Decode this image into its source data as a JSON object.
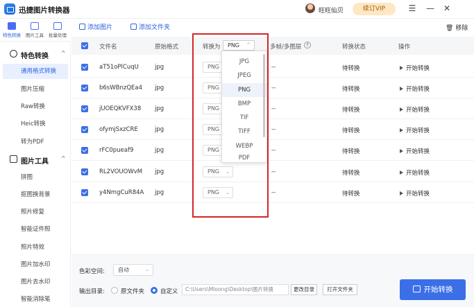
{
  "app": {
    "title": "迅捷图片转换器",
    "username": "旺旺仙贝",
    "vip_label": "续订VIP"
  },
  "window_controls": {
    "menu": "☰",
    "minimize": "—",
    "close": "✕"
  },
  "side_tabs": [
    {
      "label": "特色转换",
      "icon": "convert-icon"
    },
    {
      "label": "图片工具",
      "icon": "tools-icon"
    },
    {
      "label": "批量处理",
      "icon": "batch-icon"
    }
  ],
  "sidebar": {
    "group1": {
      "label": "特色转换",
      "chevron": "^"
    },
    "group1_items": [
      "通用格式转换",
      "图片压缩",
      "Raw转换",
      "Heic转换",
      "转为PDF"
    ],
    "group2": {
      "label": "图片工具",
      "chevron": "^"
    },
    "group2_items": [
      "拼图",
      "抠图换背景",
      "照片修复",
      "智能证件照",
      "照片特效",
      "图片加水印",
      "图片去水印",
      "智能消除笔"
    ]
  },
  "toolbar": {
    "add_image": "添加图片",
    "add_folder": "添加文件夹",
    "remove": "移除"
  },
  "table": {
    "headers": {
      "filename": "文件名",
      "orig_format": "原始格式",
      "convert_to": "转换为",
      "multi_frame": "多帧/多图层",
      "status": "转换状态",
      "action": "操作"
    },
    "header_select_value": "PNG",
    "rows": [
      {
        "name": "aT51oPlCuqU",
        "format": "jpg",
        "target": "PNG",
        "frames": "--",
        "status": "待转换",
        "action": "开始转换"
      },
      {
        "name": "b6sWBnzQEa4",
        "format": "jpg",
        "target": "PNG",
        "frames": "--",
        "status": "待转换",
        "action": "开始转换"
      },
      {
        "name": "jUOEQKVFX38",
        "format": "jpg",
        "target": "PNG",
        "frames": "--",
        "status": "待转换",
        "action": "开始转换"
      },
      {
        "name": "ofymjSxzCRE",
        "format": "jpg",
        "target": "PNG",
        "frames": "--",
        "status": "待转换",
        "action": "开始转换"
      },
      {
        "name": "rFC0pueaf9",
        "format": "jpg",
        "target": "PNG",
        "frames": "--",
        "status": "待转换",
        "action": "开始转换"
      },
      {
        "name": "RL2VOUOWvM",
        "format": "jpg",
        "target": "PNG",
        "frames": "--",
        "status": "待转换",
        "action": "开始转换"
      },
      {
        "name": "y4NmgCuR84A",
        "format": "jpg",
        "target": "PNG",
        "frames": "--",
        "status": "待转换",
        "action": "开始转换"
      }
    ]
  },
  "dropdown": {
    "options": [
      "JPG",
      "JPEG",
      "PNG",
      "BMP",
      "TIF",
      "TIFF",
      "WEBP",
      "PDF"
    ],
    "selected": "PNG"
  },
  "footer": {
    "color_space_label": "色彩空间:",
    "color_space_value": "自动",
    "output_label": "输出目录:",
    "option_source": "原文件夹",
    "option_custom": "自定义",
    "path": "C:\\Users\\Mloong\\Desktop\\图片转换",
    "change_dir": "更改目录",
    "open_folder": "打开文件夹",
    "convert_button": "开始转换"
  },
  "colors": {
    "accent": "#3b6fe8",
    "highlight": "#d42626",
    "vip_bg": "#ffe7c2"
  }
}
